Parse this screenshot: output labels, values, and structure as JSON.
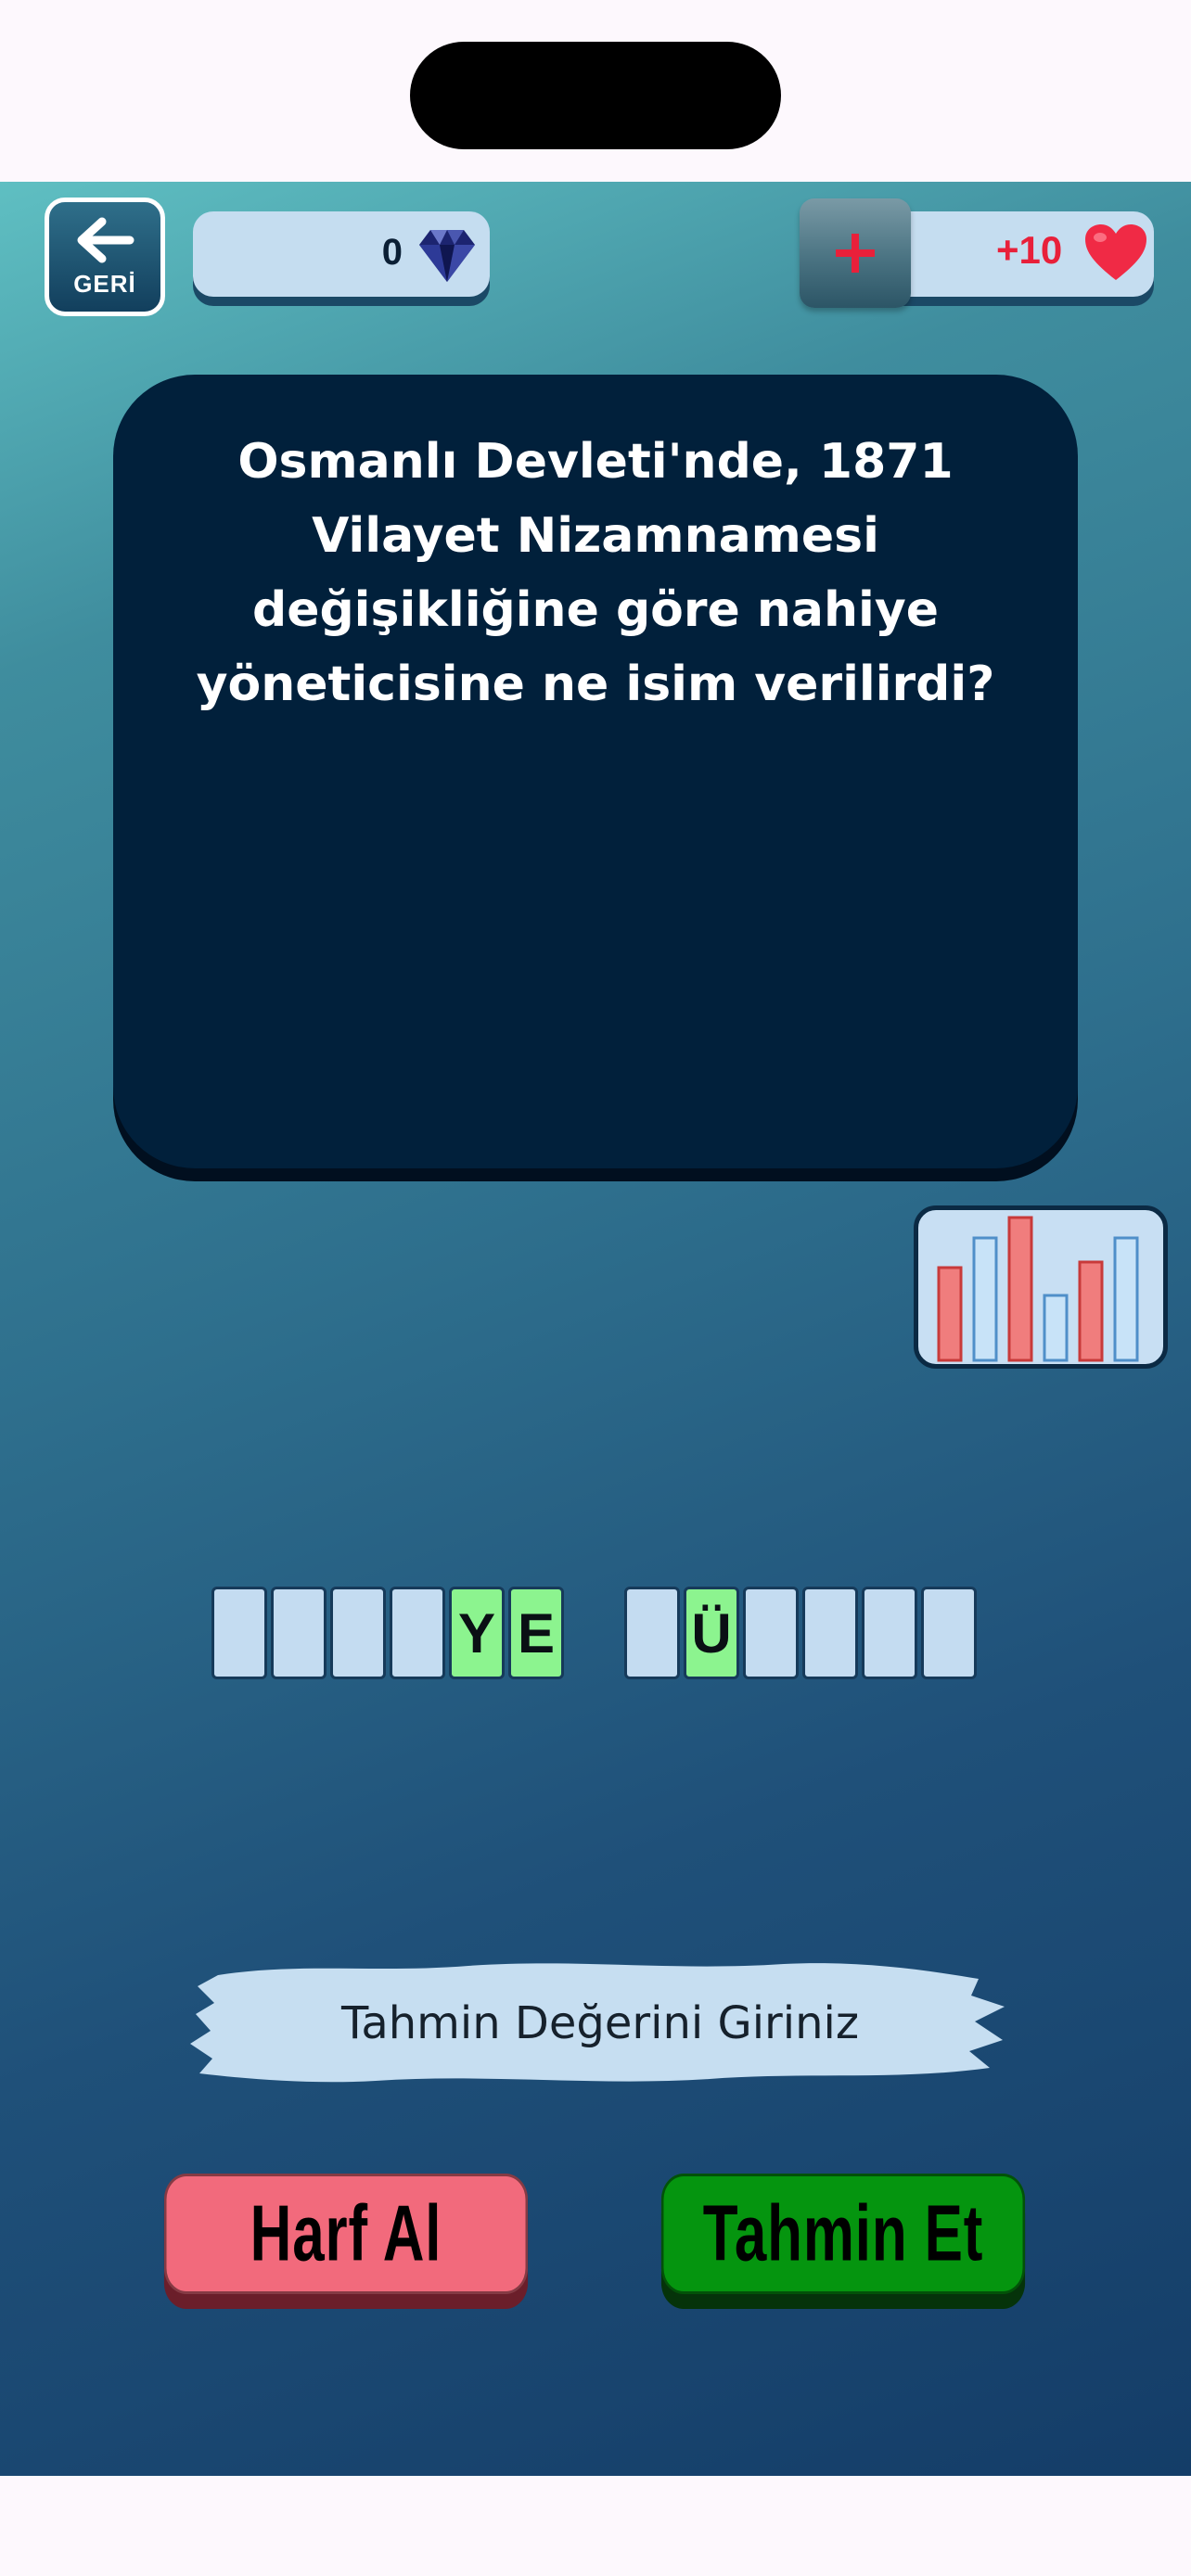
{
  "header": {
    "back_label": "GERİ",
    "gems": "0",
    "lives": "+10"
  },
  "question": {
    "text": "Osmanlı Devleti'nde, 1871 Vilayet Nizamnamesi değişikliğine göre nahiye yöneticisine ne isim verilirdi?"
  },
  "answer": {
    "words": [
      [
        "",
        "",
        "",
        "",
        "Y",
        "E"
      ],
      [
        "",
        "Ü",
        "",
        "",
        "",
        ""
      ]
    ]
  },
  "input": {
    "placeholder": "Tahmin Değerini Giriniz"
  },
  "buttons": {
    "hint_label": "Harf Al",
    "guess_label": "Tahmin Et"
  },
  "colors": {
    "card": "#01203b",
    "tile_empty": "#c4dcf1",
    "tile_revealed": "#8cf48f",
    "hint_button": "#f26a7c",
    "guess_button": "#05950f",
    "heart": "#e8203a"
  },
  "icons": {
    "back": "arrow-left-icon",
    "gem": "diamond-icon",
    "plus": "plus-icon",
    "heart": "heart-icon",
    "stats": "bar-chart-icon"
  }
}
